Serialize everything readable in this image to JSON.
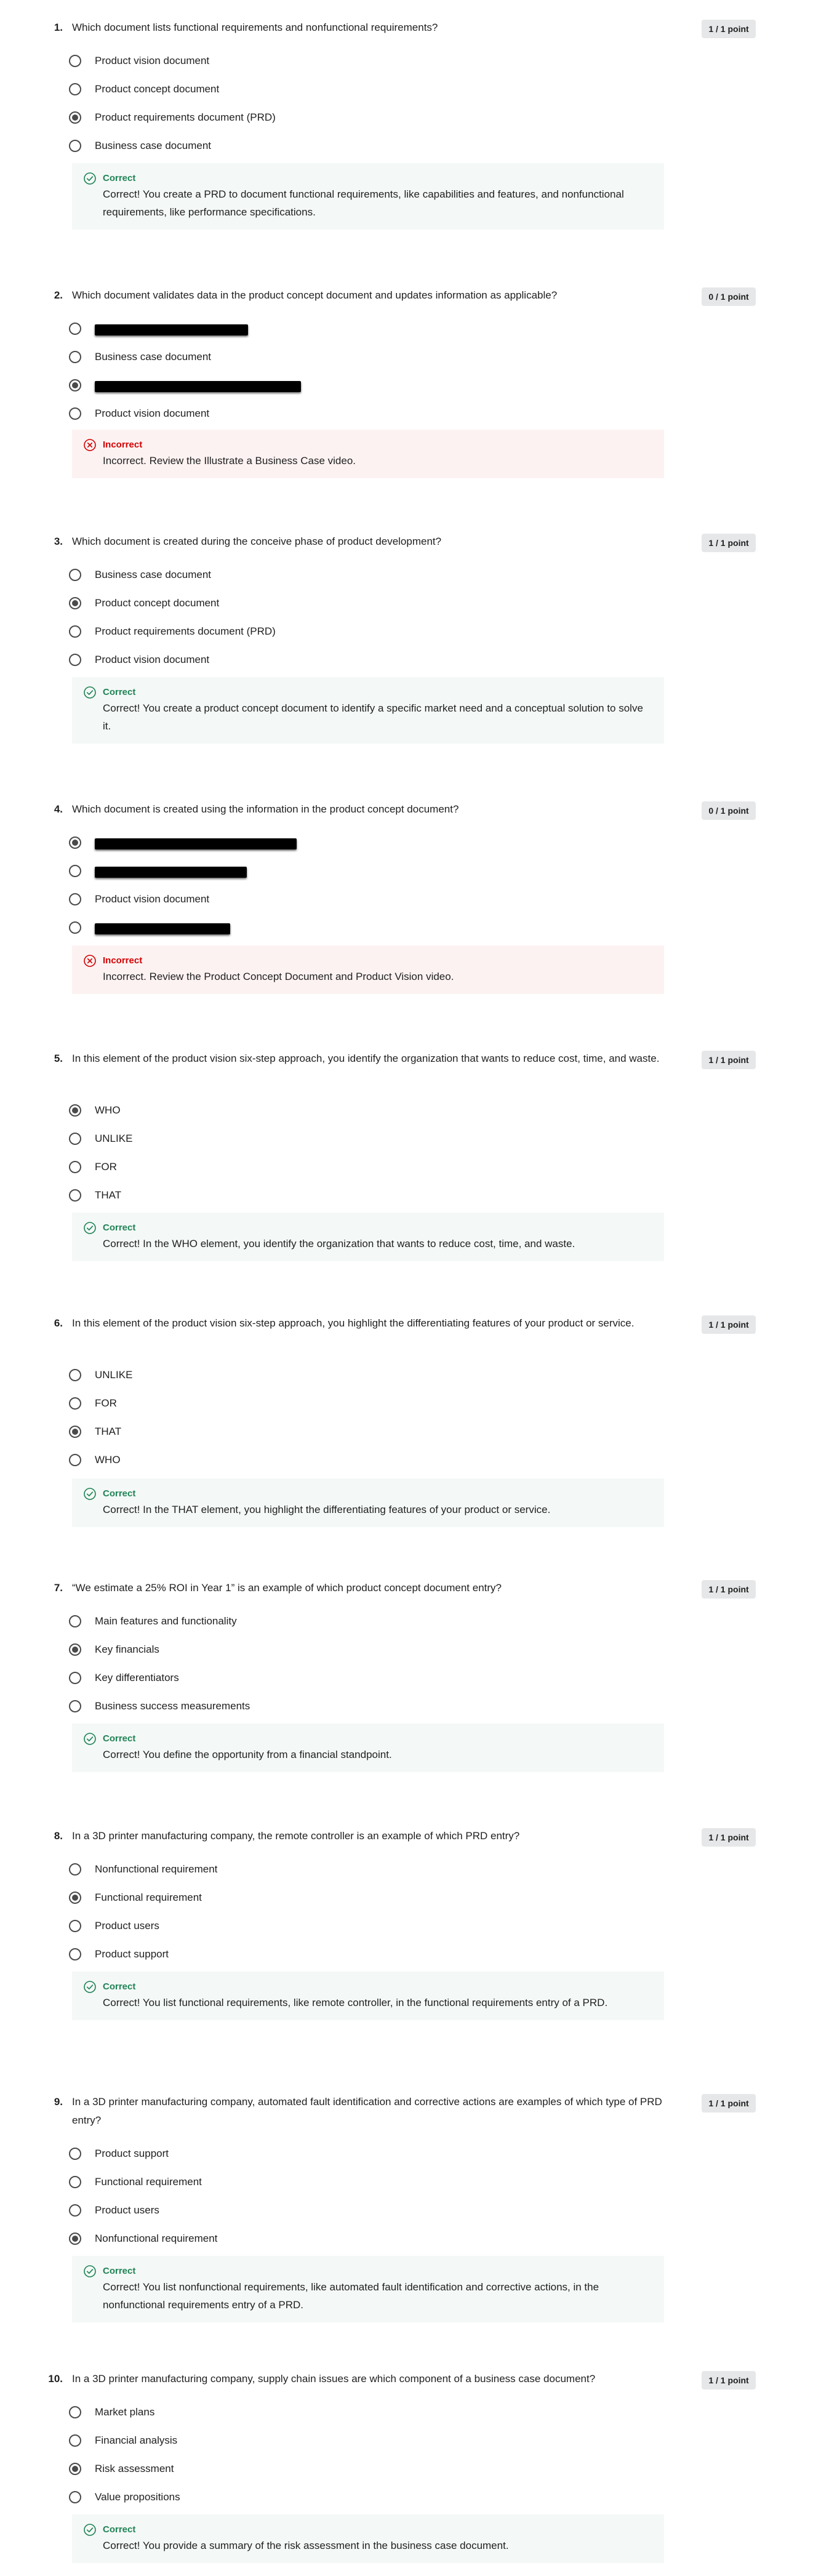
{
  "questions": [
    {
      "number": "1.",
      "text": "Which document lists functional requirements and nonfunctional requirements?",
      "points": "1 / 1 point",
      "options": [
        {
          "label": "Product vision document",
          "selected": false
        },
        {
          "label": "Product concept document",
          "selected": false
        },
        {
          "label": "Product requirements document (PRD)",
          "selected": true
        },
        {
          "label": "Business case document",
          "selected": false
        }
      ],
      "feedback": {
        "status": "correct",
        "title": "Correct",
        "text": "Correct! You create a PRD to document functional requirements, like capabilities and features, and nonfunctional requirements, like performance specifications."
      }
    },
    {
      "number": "2.",
      "text": "Which document validates data in the product concept document and updates information as applicable?",
      "points": "0 / 1 point",
      "options": [
        {
          "label": "",
          "selected": false,
          "redacted": true
        },
        {
          "label": "Business case document",
          "selected": false
        },
        {
          "label": "",
          "selected": true,
          "redacted": true
        },
        {
          "label": "Product vision document",
          "selected": false
        }
      ],
      "feedback": {
        "status": "incorrect",
        "title": "Incorrect",
        "text": "Incorrect. Review the Illustrate a Business Case video."
      }
    },
    {
      "number": "3.",
      "text": "Which document is created during the conceive phase of product development?",
      "points": "1 / 1 point",
      "options": [
        {
          "label": "Business case document",
          "selected": false
        },
        {
          "label": "Product concept document",
          "selected": true
        },
        {
          "label": "Product requirements document (PRD)",
          "selected": false
        },
        {
          "label": "Product vision document",
          "selected": false
        }
      ],
      "feedback": {
        "status": "correct",
        "title": "Correct",
        "text": "Correct! You create a product concept document to identify a specific market need and a conceptual solution to solve it."
      }
    },
    {
      "number": "4.",
      "text": "Which document is created using the information in the product concept document?",
      "points": "0 / 1 point",
      "options": [
        {
          "label": "",
          "selected": true,
          "redacted": true
        },
        {
          "label": "",
          "selected": false,
          "redacted": true
        },
        {
          "label": "Product vision document",
          "selected": false
        },
        {
          "label": "",
          "selected": false,
          "redacted": true
        }
      ],
      "feedback": {
        "status": "incorrect",
        "title": "Incorrect",
        "text": "Incorrect. Review the Product Concept Document and Product Vision video."
      }
    },
    {
      "number": "5.",
      "text": "In this element of the product vision six-step approach, you identify the organization that wants to reduce cost, time, and waste.",
      "points": "1 / 1 point",
      "options": [
        {
          "label": "WHO",
          "selected": true
        },
        {
          "label": "UNLIKE",
          "selected": false
        },
        {
          "label": "FOR",
          "selected": false
        },
        {
          "label": "THAT",
          "selected": false
        }
      ],
      "feedback": {
        "status": "correct",
        "title": "Correct",
        "text": "Correct! In the WHO element, you identify the organization that wants to reduce cost, time, and waste."
      }
    },
    {
      "number": "6.",
      "text": "In this element of the product vision six-step approach, you highlight the differentiating features of your product or service.",
      "points": "1 / 1 point",
      "options": [
        {
          "label": "UNLIKE",
          "selected": false
        },
        {
          "label": "FOR",
          "selected": false
        },
        {
          "label": "THAT",
          "selected": true
        },
        {
          "label": "WHO",
          "selected": false
        }
      ],
      "feedback": {
        "status": "correct",
        "title": "Correct",
        "text": "Correct! In the THAT element, you highlight the differentiating features of your product or service."
      }
    },
    {
      "number": "7.",
      "text": "“We estimate a 25% ROI in Year 1” is an example of which product concept document entry?",
      "points": "1 / 1 point",
      "options": [
        {
          "label": "Main features and functionality",
          "selected": false
        },
        {
          "label": "Key financials",
          "selected": true
        },
        {
          "label": "Key differentiators",
          "selected": false
        },
        {
          "label": "Business success measurements",
          "selected": false
        }
      ],
      "feedback": {
        "status": "correct",
        "title": "Correct",
        "text": "Correct! You define the opportunity from a financial standpoint."
      }
    },
    {
      "number": "8.",
      "text": "In a 3D printer manufacturing company, the remote controller is an example of which PRD entry?",
      "points": "1 / 1 point",
      "options": [
        {
          "label": "Nonfunctional requirement",
          "selected": false
        },
        {
          "label": "Functional requirement",
          "selected": true
        },
        {
          "label": "Product users",
          "selected": false
        },
        {
          "label": "Product support",
          "selected": false
        }
      ],
      "feedback": {
        "status": "correct",
        "title": "Correct",
        "text": "Correct! You list functional requirements, like remote controller, in the functional requirements entry of a PRD."
      }
    },
    {
      "number": "9.",
      "text": "In a 3D printer manufacturing company, automated fault identification and corrective actions are examples of which type of PRD entry?",
      "points": "1 / 1 point",
      "options": [
        {
          "label": "Product support",
          "selected": false
        },
        {
          "label": "Functional requirement",
          "selected": false
        },
        {
          "label": "Product users",
          "selected": false
        },
        {
          "label": "Nonfunctional requirement",
          "selected": true
        }
      ],
      "feedback": {
        "status": "correct",
        "title": "Correct",
        "text": "Correct! You list nonfunctional requirements, like automated fault identification and corrective actions, in the nonfunctional requirements entry of a PRD."
      }
    },
    {
      "number": "10.",
      "text": "In a 3D printer manufacturing company, supply chain issues are which component of a business case document?",
      "points": "1 / 1 point",
      "options": [
        {
          "label": "Market plans",
          "selected": false
        },
        {
          "label": "Financial analysis",
          "selected": false
        },
        {
          "label": "Risk assessment",
          "selected": true
        },
        {
          "label": "Value propositions",
          "selected": false
        }
      ],
      "feedback": {
        "status": "correct",
        "title": "Correct",
        "text": "Correct! You provide a summary of the risk assessment in the business case document."
      }
    }
  ],
  "colors": {
    "correct": "#1f8354",
    "incorrect": "#d30001",
    "correct_bg": "#f4f8f7",
    "incorrect_bg": "#fdf2f2"
  },
  "icons": {
    "correct": "check-circle-icon",
    "incorrect": "x-circle-icon"
  }
}
